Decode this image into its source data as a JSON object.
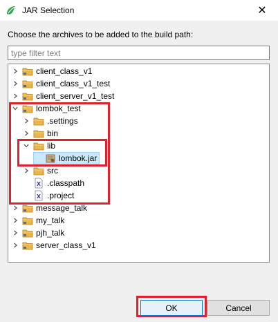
{
  "window": {
    "title": "JAR Selection",
    "close_glyph": "✕"
  },
  "instruction": "Choose the archives to be added to the build path:",
  "filter": {
    "placeholder": "type filter text",
    "value": ""
  },
  "tree": [
    {
      "label": "client_class_v1",
      "icon": "project-folder-icon",
      "expanded": false,
      "level": 0
    },
    {
      "label": "client_class_v1_test",
      "icon": "project-folder-icon",
      "expanded": false,
      "level": 0
    },
    {
      "label": "client_server_v1_test",
      "icon": "project-folder-icon",
      "expanded": false,
      "level": 0
    },
    {
      "label": "lombok_test",
      "icon": "project-folder-icon",
      "expanded": true,
      "level": 0
    },
    {
      "label": ".settings",
      "icon": "folder-icon",
      "expanded": false,
      "level": 1
    },
    {
      "label": "bin",
      "icon": "folder-icon",
      "expanded": false,
      "level": 1
    },
    {
      "label": "lib",
      "icon": "folder-icon",
      "expanded": true,
      "level": 1
    },
    {
      "label": "lombok.jar",
      "icon": "jar-icon",
      "level": 2,
      "selected": true
    },
    {
      "label": "src",
      "icon": "folder-icon",
      "expanded": false,
      "level": 1
    },
    {
      "label": ".classpath",
      "icon": "xml-file-icon",
      "level": 1
    },
    {
      "label": ".project",
      "icon": "xml-file-icon",
      "level": 1
    },
    {
      "label": "message_talk",
      "icon": "project-folder-icon",
      "expanded": false,
      "level": 0
    },
    {
      "label": "my_talk",
      "icon": "project-folder-icon",
      "expanded": false,
      "level": 0
    },
    {
      "label": "pjh_talk",
      "icon": "project-folder-icon",
      "expanded": false,
      "level": 0
    },
    {
      "label": "server_class_v1",
      "icon": "project-folder-icon",
      "expanded": false,
      "level": 0
    }
  ],
  "buttons": {
    "ok": "OK",
    "cancel": "Cancel"
  },
  "colors": {
    "highlight": "#e0202a",
    "selection": "#cce8ff",
    "folder": "#e8b64a"
  }
}
